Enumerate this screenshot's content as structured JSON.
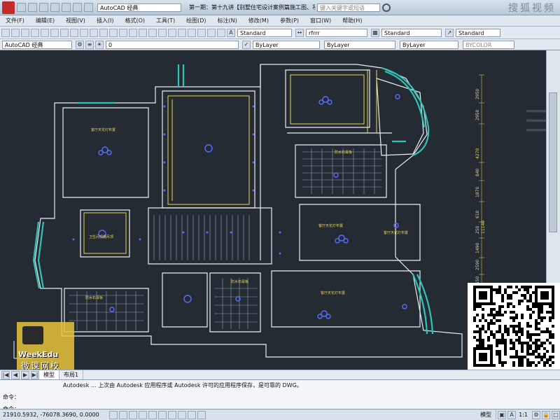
{
  "titlebar": {
    "workspace": "AutoCAD 经典",
    "title": "第一期：第十九讲【别墅住宅设计案例篇施工图、吊顶】",
    "search_placeholder": "键入关键字或短语"
  },
  "menubar": {
    "items": [
      "文件(F)",
      "编辑(E)",
      "视图(V)",
      "插入(I)",
      "格式(O)",
      "工具(T)",
      "绘图(D)",
      "标注(N)",
      "修改(M)",
      "参数(P)",
      "窗口(W)",
      "帮助(H)"
    ]
  },
  "toolbar1": {
    "text_style": "Standard",
    "dim_style": "rfrrr",
    "table_style": "Standard",
    "multileader_style": "Standard"
  },
  "toolbar2": {
    "workspace": "AutoCAD 经典",
    "layer": "0",
    "color": "ByLayer",
    "linetype": "ByLayer",
    "lineweight": "ByLayer",
    "plotstyle": "BYCOLOR"
  },
  "drawing": {
    "room_labels": [
      "客厅天花灯布置",
      "防水石膏板",
      "防水石膏板",
      "卫生间顶棚吊顶",
      "防水石膏板",
      "客厅天花灯布置",
      "客厅天花灯布置",
      "客厅天花灯布置"
    ],
    "dims": [
      "2950",
      "2950",
      "4270",
      "840",
      "1870",
      "610",
      "250",
      "11140",
      "1490",
      "2590",
      "2550",
      "310",
      "2670"
    ]
  },
  "tabs": [
    "模型",
    "布局1"
  ],
  "command": {
    "history": "Autodesk  ... 上次由 Autodesk 应用程序或 Autodesk 许可的应用程序保存，是可靠的 DWG。",
    "prompt1": "命令：",
    "prompt2": "命令："
  },
  "status": {
    "coords": "21910.5932, -76078.3690, 0.0000",
    "model_label": "模型",
    "scale": "1:1"
  },
  "overlay": {
    "logo_line1": "WeekEdu",
    "logo_line2": "微课网校",
    "logo_slogan1": "版权",
    "logo_slogan2": "所有",
    "logo_slogan3": "翻版",
    "logo_slogan4": "必究",
    "watermark_top": "搜狐视频"
  },
  "colors": {
    "wall": "#e8eef5",
    "window": "#2fc3b5",
    "text": "#e8d35a",
    "light": "#5a6cff",
    "background": "#242b33"
  }
}
